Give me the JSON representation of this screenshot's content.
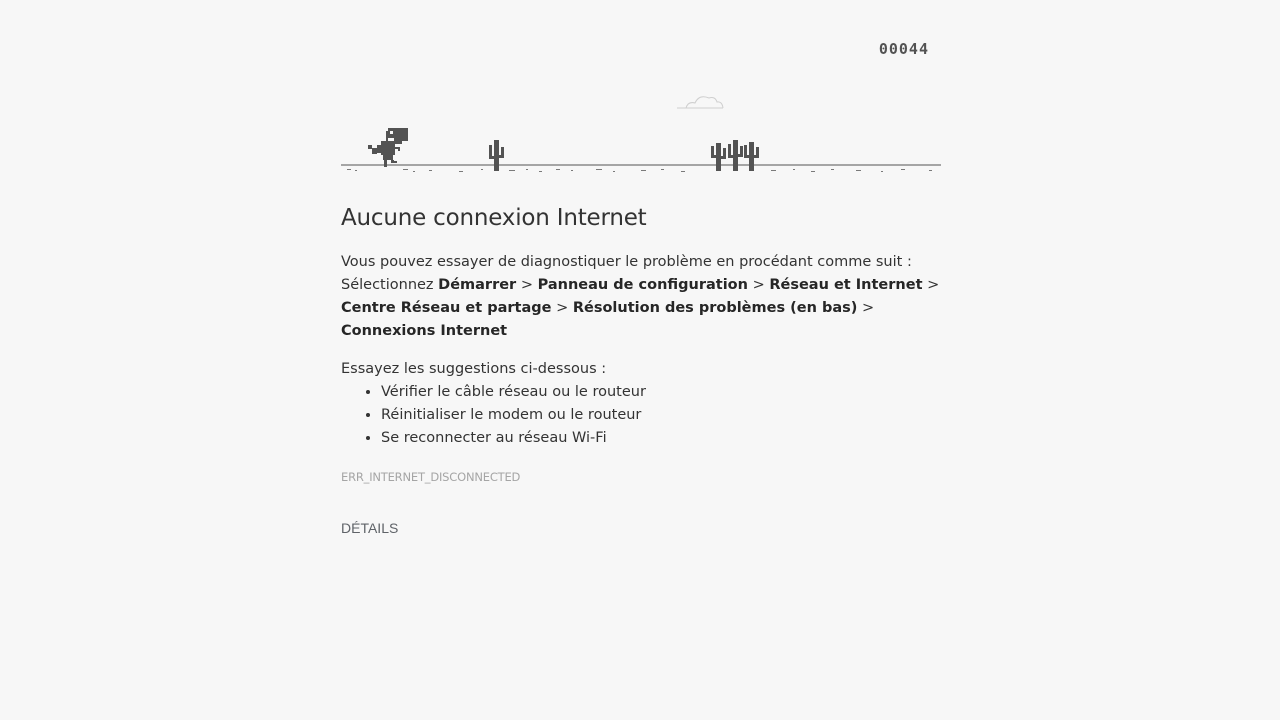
{
  "game": {
    "score": "00044",
    "icons": {
      "player": "t-rex-dinosaur-icon",
      "obstacle": "cactus-icon",
      "sky": "cloud-icon"
    },
    "colors": {
      "sprite": "#535353",
      "cloud": "#dadada"
    }
  },
  "message": {
    "title": "Aucune connexion Internet",
    "intro": "Vous pouvez essayer de diagnostiquer le problème en procédant comme suit :",
    "select_prefix": "Sélectionnez",
    "path": [
      "Démarrer",
      "Panneau de configuration",
      "Réseau et Internet",
      "Centre Réseau et partage",
      "Résolution des problèmes (en bas)",
      "Connexions Internet"
    ],
    "separator": ">",
    "suggestions_title": "Essayez les suggestions ci-dessous :",
    "suggestions": [
      "Vérifier le câble réseau ou le routeur",
      "Réinitialiser le modem ou le routeur",
      "Se reconnecter au réseau Wi-Fi"
    ],
    "error_code": "ERR_INTERNET_DISCONNECTED"
  },
  "details_button": "DÉTAILS",
  "background_color": "#f7f7f7"
}
